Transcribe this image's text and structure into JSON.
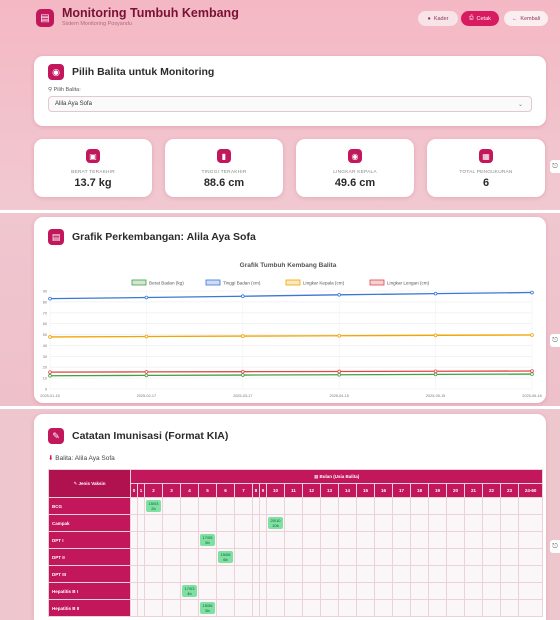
{
  "header": {
    "title": "Monitoring Tumbuh Kembang",
    "subtitle": "Sistem Monitoring Posyandu",
    "btn_kader": "Kader",
    "btn_cetak": "Cetak",
    "btn_kembali": "Kembali"
  },
  "selector": {
    "title": "Pilih Balita untuk Monitoring",
    "label": "Pilih Balita:",
    "value": "Alila Aya Sofa"
  },
  "stats": [
    {
      "label": "BERAT TERAKHIR",
      "value": "13.7 kg"
    },
    {
      "label": "TINGGI TERAKHIR",
      "value": "88.6 cm"
    },
    {
      "label": "LINGKAR KEPALA",
      "value": "49.6 cm"
    },
    {
      "label": "TOTAL PENGUKURAN",
      "value": "6"
    }
  ],
  "chart_section": {
    "title": "Grafik Perkembangan: Alila Aya Sofa"
  },
  "chart_data": {
    "type": "line",
    "title": "Grafik Tumbuh Kembang Balita",
    "x": [
      "2025-01-15",
      "2025-02-17",
      "2025-03-17",
      "2025-04-15",
      "2025-05-15",
      "2025-06-16"
    ],
    "ylim": [
      0,
      90
    ],
    "yticks": [
      0,
      10,
      20,
      30,
      40,
      50,
      60,
      70,
      80,
      90
    ],
    "legend_position": "top",
    "grid": true,
    "series": [
      {
        "name": "Berat Badan (kg)",
        "color": "#43a047",
        "values": [
          12.2,
          12.5,
          12.8,
          13.1,
          13.4,
          13.7
        ]
      },
      {
        "name": "Tinggi Badan (cm)",
        "color": "#3a78d6",
        "values": [
          83.0,
          84.0,
          85.2,
          86.5,
          87.6,
          88.6
        ]
      },
      {
        "name": "Lingkar Kepala (cm)",
        "color": "#f0a500",
        "values": [
          47.8,
          48.2,
          48.6,
          48.9,
          49.3,
          49.6
        ]
      },
      {
        "name": "Lingkar Lengan (cm)",
        "color": "#e04848",
        "values": [
          15.5,
          15.7,
          15.9,
          16.1,
          16.3,
          16.5
        ]
      }
    ]
  },
  "immunization": {
    "title": "Catatan Imunisasi (Format KIA)",
    "balita_label": "Balita: Alila Aya Sofa",
    "col_vaksin": "Jenis Vaksin",
    "col_bulan": "Bulan (Usia Balita)",
    "months": [
      "0",
      "1",
      "2",
      "3",
      "4",
      "5",
      "6",
      "7",
      "8",
      "9",
      "10",
      "11",
      "12",
      "13",
      "14",
      "15",
      "16",
      "17",
      "18",
      "19",
      "20",
      "21",
      "22",
      "23",
      "24-60"
    ],
    "rows": [
      {
        "vaccine": "BCG",
        "month_index": 2,
        "date": "15/03",
        "tag": "2b"
      },
      {
        "vaccine": "Campak",
        "month_index": 10,
        "date": "20/10",
        "tag": "10b"
      },
      {
        "vaccine": "DPT I",
        "month_index": 5,
        "date": "17/05",
        "tag": "5b"
      },
      {
        "vaccine": "DPT II",
        "month_index": 6,
        "date": "15/06",
        "tag": "6b"
      },
      {
        "vaccine": "DPT III",
        "month_index": null,
        "date": "",
        "tag": ""
      },
      {
        "vaccine": "Hepatitis B I",
        "month_index": 4,
        "date": "17/03",
        "tag": "4b"
      },
      {
        "vaccine": "Hepatitis B II",
        "month_index": 5,
        "date": "15/06",
        "tag": "5b"
      }
    ]
  }
}
